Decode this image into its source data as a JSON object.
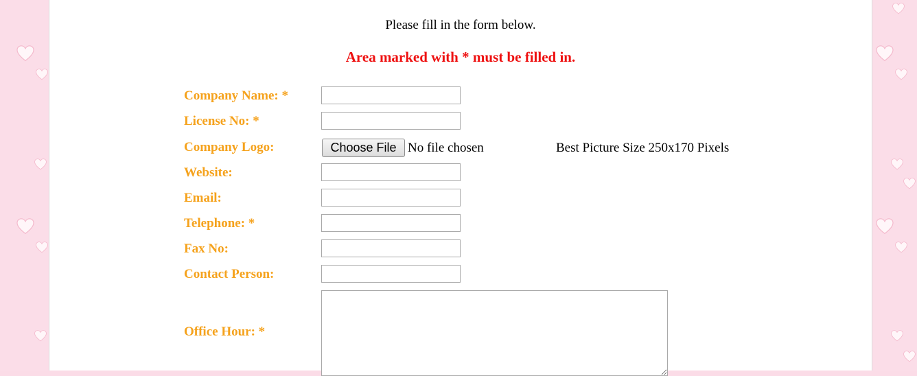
{
  "form": {
    "intro": "Please fill in the form below.",
    "required_note": "Area marked with * must be filled in.",
    "fields": {
      "company_name": {
        "label": "Company Name: *",
        "value": ""
      },
      "license_no": {
        "label": "License No: *",
        "value": ""
      },
      "company_logo": {
        "label": "Company Logo:",
        "button": "Choose File",
        "status": "No file chosen",
        "hint": "Best Picture Size 250x170 Pixels"
      },
      "website": {
        "label": "Website:",
        "value": ""
      },
      "email": {
        "label": "Email:",
        "value": ""
      },
      "telephone": {
        "label": "Telephone: *",
        "value": ""
      },
      "fax_no": {
        "label": "Fax No:",
        "value": ""
      },
      "contact_person": {
        "label": "Contact Person:",
        "value": ""
      },
      "office_hour": {
        "label": "Office Hour: *",
        "value": ""
      }
    }
  },
  "theme": {
    "label_color": "#f5a21c",
    "required_note_color": "#ee1111",
    "side_background": "#fbdce7",
    "decoration": "heart-icon"
  }
}
